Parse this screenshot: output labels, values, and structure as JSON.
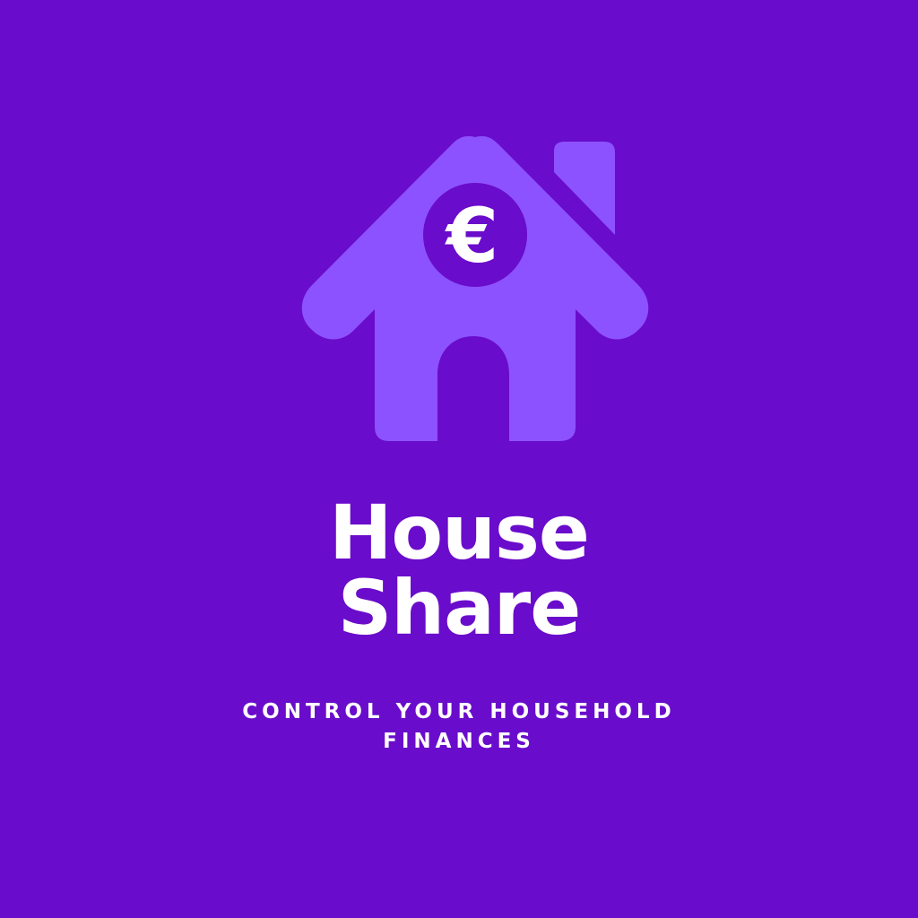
{
  "brand": {
    "title_line_1": "House",
    "title_line_2": "Share",
    "tagline": "CONTROL YOUR HOUSEHOLD FINANCES",
    "currency_symbol": "€"
  },
  "colors": {
    "background": "#6a0ccb",
    "house": "#8c52ff",
    "coin": "#6a0ccb",
    "text": "#ffffff"
  },
  "icons": {
    "logo": "house-euro-icon"
  }
}
